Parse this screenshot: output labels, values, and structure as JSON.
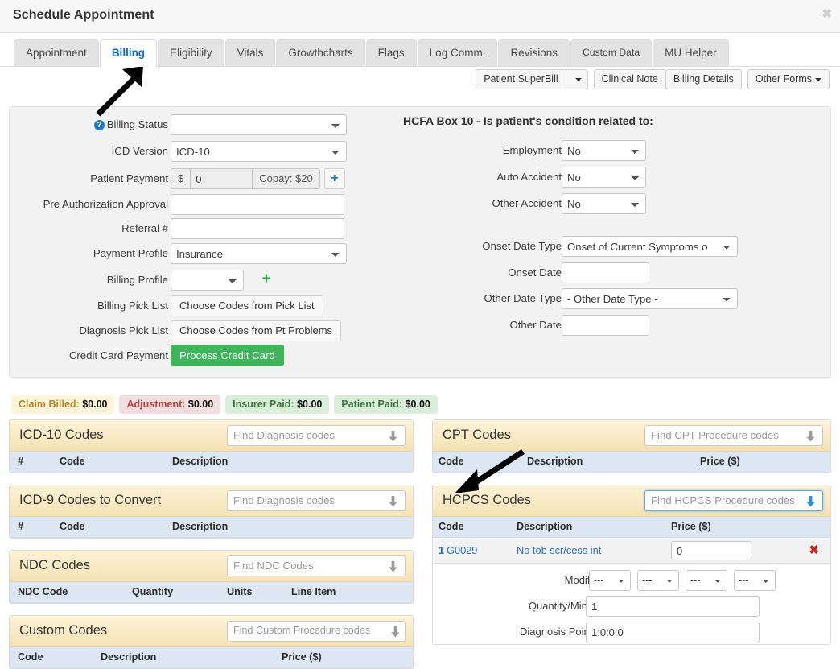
{
  "window": {
    "title": "Schedule Appointment",
    "close_label": "✖"
  },
  "tabs": [
    {
      "label": "Appointment",
      "active": false
    },
    {
      "label": "Billing",
      "active": true
    },
    {
      "label": "Eligibility",
      "active": false
    },
    {
      "label": "Vitals",
      "active": false
    },
    {
      "label": "Growthcharts",
      "active": false
    },
    {
      "label": "Flags",
      "active": false
    },
    {
      "label": "Log Comm.",
      "active": false
    },
    {
      "label": "Revisions",
      "active": false
    },
    {
      "label": "Custom Data",
      "active": false
    },
    {
      "label": "MU Helper",
      "active": false
    }
  ],
  "actionbar": {
    "patient_superbill": "Patient SuperBill",
    "superbill_caret": "",
    "clinical_note": "Clinical Note",
    "billing_details": "Billing Details",
    "other_forms": "Other Forms"
  },
  "billing_form": {
    "billing_status": {
      "label": "Billing Status",
      "value": "",
      "help_icon": "?"
    },
    "icd_version": {
      "label": "ICD Version",
      "value": "ICD-10"
    },
    "patient_payment": {
      "label": "Patient Payment",
      "currency": "$",
      "value": "0",
      "copay": "Copay: $20",
      "add": "+"
    },
    "pre_auth": {
      "label": "Pre Authorization Approval",
      "value": ""
    },
    "referral": {
      "label": "Referral #",
      "value": ""
    },
    "payment_profile": {
      "label": "Payment Profile",
      "value": "Insurance"
    },
    "billing_profile": {
      "label": "Billing Profile",
      "value": "",
      "add": "+"
    },
    "billing_pick_list": {
      "label": "Billing Pick List",
      "button": "Choose Codes from Pick List"
    },
    "diagnosis_pick_list": {
      "label": "Diagnosis Pick List",
      "button": "Choose Codes from Pt Problems"
    },
    "credit_card": {
      "label": "Credit Card Payment",
      "button": "Process Credit Card"
    }
  },
  "hcfa": {
    "title": "HCFA Box 10 - Is patient's condition related to:",
    "employment": {
      "label": "Employment",
      "value": "No"
    },
    "auto_accident": {
      "label": "Auto Accident",
      "value": "No"
    },
    "other_accident": {
      "label": "Other Accident",
      "value": "No"
    },
    "onset_date_type": {
      "label": "Onset Date Type",
      "value": "Onset of Current Symptoms o"
    },
    "onset_date": {
      "label": "Onset Date",
      "value": ""
    },
    "other_date_type": {
      "label": "Other Date Type",
      "value": "- Other Date Type -"
    },
    "other_date": {
      "label": "Other Date",
      "value": ""
    }
  },
  "badges": [
    {
      "label": "Claim Billed:",
      "amount": "$0.00",
      "style": "warn"
    },
    {
      "label": "Adjustment:",
      "amount": "$0.00",
      "style": "danger"
    },
    {
      "label": "Insurer Paid:",
      "amount": "$0.00",
      "style": "succ"
    },
    {
      "label": "Patient Paid:",
      "amount": "$0.00",
      "style": "succ"
    }
  ],
  "panels": {
    "icd10": {
      "title": "ICD-10 Codes",
      "placeholder": "Find Diagnosis codes",
      "columns": [
        "#",
        "Code",
        "Description"
      ],
      "rows": []
    },
    "icd9": {
      "title": "ICD-9 Codes to Convert",
      "placeholder": "Find Diagnosis codes",
      "columns": [
        "#",
        "Code",
        "Description"
      ],
      "rows": []
    },
    "ndc": {
      "title": "NDC Codes",
      "placeholder": "Find NDC Codes",
      "columns": [
        "NDC Code",
        "Quantity",
        "Units",
        "Line Item"
      ],
      "rows": []
    },
    "custom": {
      "title": "Custom Codes",
      "placeholder": "Find Custom Procedure codes",
      "columns": [
        "Code",
        "Description",
        "Price ($)"
      ],
      "rows": []
    },
    "cpt": {
      "title": "CPT Codes",
      "placeholder": "Find CPT Procedure codes",
      "columns": [
        "Code",
        "Description",
        "Price ($)"
      ],
      "rows": []
    },
    "hcpcs": {
      "title": "HCPCS Codes",
      "placeholder": "Find HCPCS Procedure codes",
      "focused": true,
      "columns": [
        "Code",
        "Description",
        "Price ($)"
      ],
      "row": {
        "num": "1",
        "code": "G0029",
        "description": "No tob scr/cess int",
        "price": "0",
        "delete": "✖"
      },
      "detail": {
        "modifiers_label": "Modifiers:",
        "modifiers": [
          "---",
          "---",
          "---",
          "---"
        ],
        "quantity_label": "Quantity/Minutes:",
        "quantity": "1",
        "pointers_label": "Diagnosis Pointers:",
        "pointers": "1:0:0:0"
      }
    }
  }
}
